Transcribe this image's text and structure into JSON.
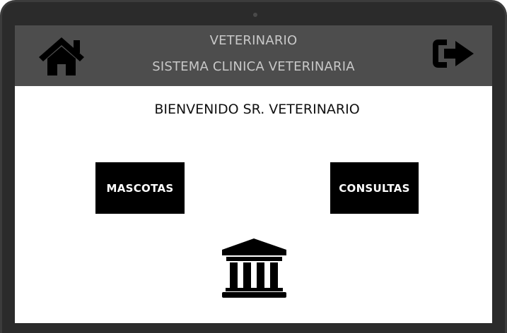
{
  "header": {
    "title": "VETERINARIO",
    "subtitle": "SISTEMA CLINICA VETERINARIA",
    "home_icon": "home-icon",
    "logout_icon": "sign-out-icon",
    "background_color": "#4d4d4d",
    "text_color": "#c8c8c8"
  },
  "main": {
    "welcome": "BIENVENIDO SR. VETERINARIO",
    "buttons": {
      "mascotas": "MASCOTAS",
      "consultas": "CONSULTAS"
    },
    "footer_icon": "institution-icon"
  }
}
